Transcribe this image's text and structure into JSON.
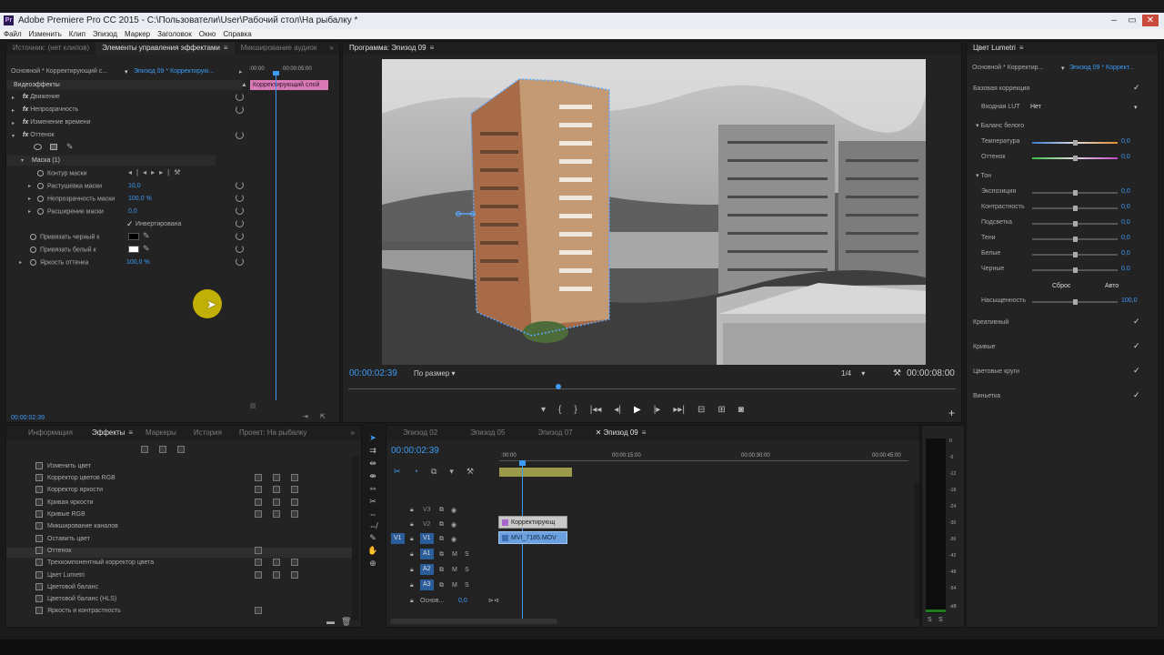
{
  "window": {
    "app_icon": "Pr",
    "title": "Adobe Premiere Pro CC 2015 - C:\\Пользователи\\User\\Рабочий стол\\На рыбалку *"
  },
  "menu": [
    "Файл",
    "Изменить",
    "Клип",
    "Эпизод",
    "Маркер",
    "Заголовок",
    "Окно",
    "Справка"
  ],
  "effect_controls": {
    "tabs": [
      "Источник: (нет клипов)",
      "Элементы управления эффектами",
      "Микширование аудиок"
    ],
    "source_label": "Основной * Корректирующий с...",
    "seq_label": "Эпизод 09 * Корректирую...",
    "tc_start": ":00:00",
    "tc_end": "00:00:05:00",
    "clip_bar": "Корректирующий слой",
    "section": "Видеоэффекты",
    "effects": [
      {
        "label": "Движение"
      },
      {
        "label": "Непрозрачность"
      },
      {
        "label": "Изменение времени"
      },
      {
        "label": "Оттенок"
      }
    ],
    "mask": "Маска (1)",
    "mask_path": "Контур маски",
    "feather": {
      "label": "Растушевка маски",
      "value": "10,0"
    },
    "opacity": {
      "label": "Непрозрачность маски",
      "value": "100,0 %"
    },
    "expansion": {
      "label": "Расширение маски",
      "value": "0,0"
    },
    "inverted": "Инвертирована",
    "map_black": "Привязать черный к",
    "map_white": "Привязать белый к",
    "amount": {
      "label": "Яркость оттенка",
      "value": "100,0 %"
    },
    "footer_tc": "00:00:02:39"
  },
  "program": {
    "tab": "Программа: Эпизод 09",
    "timecode": "00:00:02:39",
    "fit": "По размер",
    "quality": "1/4",
    "duration": "00:00:08:00"
  },
  "lumetri": {
    "tab": "Цвет Lumetri",
    "source": "Основной * Корректир...",
    "seq": "Эпизод 09 * Коррект...",
    "basic": "Базовая коррекция",
    "input_lut": {
      "label": "Входная LUT",
      "value": "Нет"
    },
    "wb": "Баланс белого",
    "sliders_wb": [
      {
        "label": "Температура",
        "value": "0,0"
      },
      {
        "label": "Оттенок",
        "value": "0,0"
      }
    ],
    "tone": "Тон",
    "sliders_tone": [
      {
        "label": "Экспозиция",
        "value": "0,0"
      },
      {
        "label": "Контрастность",
        "value": "0,0"
      },
      {
        "label": "Подсветка",
        "value": "0,0"
      },
      {
        "label": "Тени",
        "value": "0,0"
      },
      {
        "label": "Белые",
        "value": "0,0"
      },
      {
        "label": "Черные",
        "value": "0,0"
      }
    ],
    "reset": "Сброс",
    "auto": "Авто",
    "saturation": {
      "label": "Насыщенность",
      "value": "100,0"
    },
    "sections": [
      "Креативный",
      "Кривые",
      "Цветовые круги",
      "Виньетка"
    ]
  },
  "effects_panel": {
    "tabs": [
      "Информация",
      "Эффекты",
      "Маркеры",
      "История",
      "Проект: На рыбалку"
    ],
    "items": [
      "Изменить цвет",
      "Корректор цветов RGB",
      "Корректор яркости",
      "Кривая яркости",
      "Кривые RGB",
      "Микширование каналов",
      "Оставить цвет",
      "Оттенок",
      "Трехкомпонентный корректор цвета",
      "Цвет Lumetri",
      "Цветовой баланс",
      "Цветовой баланс (HLS)",
      "Яркость и контрастность"
    ]
  },
  "timeline": {
    "tabs": [
      "Эпизод 02",
      "Эпизод 05",
      "Эпизод 07",
      "Эпизод 09"
    ],
    "timecode": "00:00:02:39",
    "ruler": [
      ":00:00",
      "00:00:15:00",
      "00:00:30:00",
      "00:00:45:00"
    ],
    "tracks_video": [
      "V3",
      "V2",
      "V1"
    ],
    "tracks_audio": [
      "A1",
      "A2",
      "A3"
    ],
    "target_video": "V1",
    "master": {
      "label": "Основ...",
      "value": "0,0"
    },
    "clip_adj": "Корректирующ",
    "clip_video": "MVI_7185.MOV"
  },
  "audio_meter": {
    "scale": [
      "0",
      "-6",
      "-12",
      "-18",
      "-24",
      "-30",
      "-36",
      "-42",
      "-48",
      "-54",
      "-dB"
    ],
    "solo": "S"
  }
}
